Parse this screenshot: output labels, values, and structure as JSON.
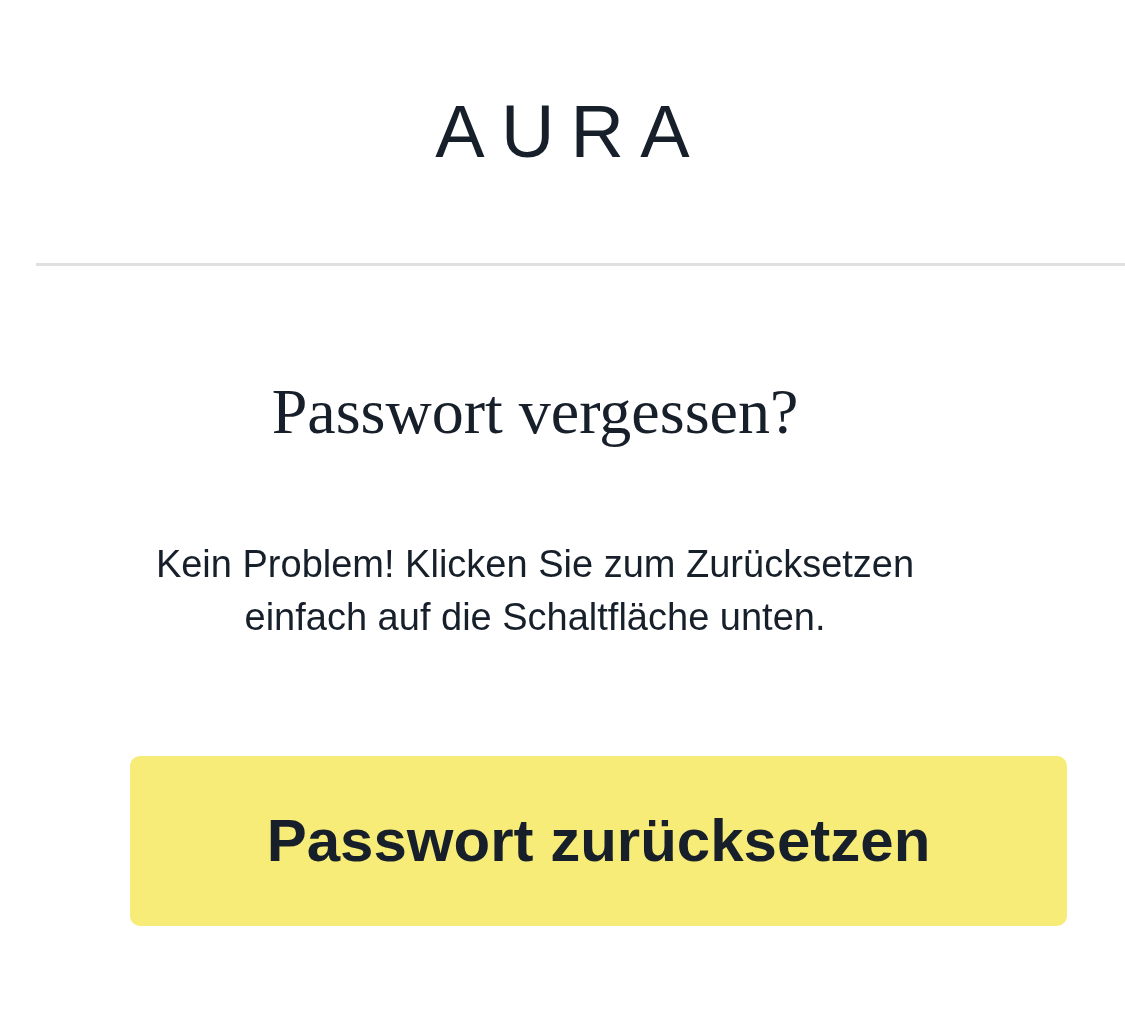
{
  "logo": "AURA",
  "title": "Passwort vergessen?",
  "message": "Kein Problem! Klicken Sie zum Zurücksetzen einfach auf die Schaltfläche unten.",
  "button": "Passwort zurücksetzen"
}
